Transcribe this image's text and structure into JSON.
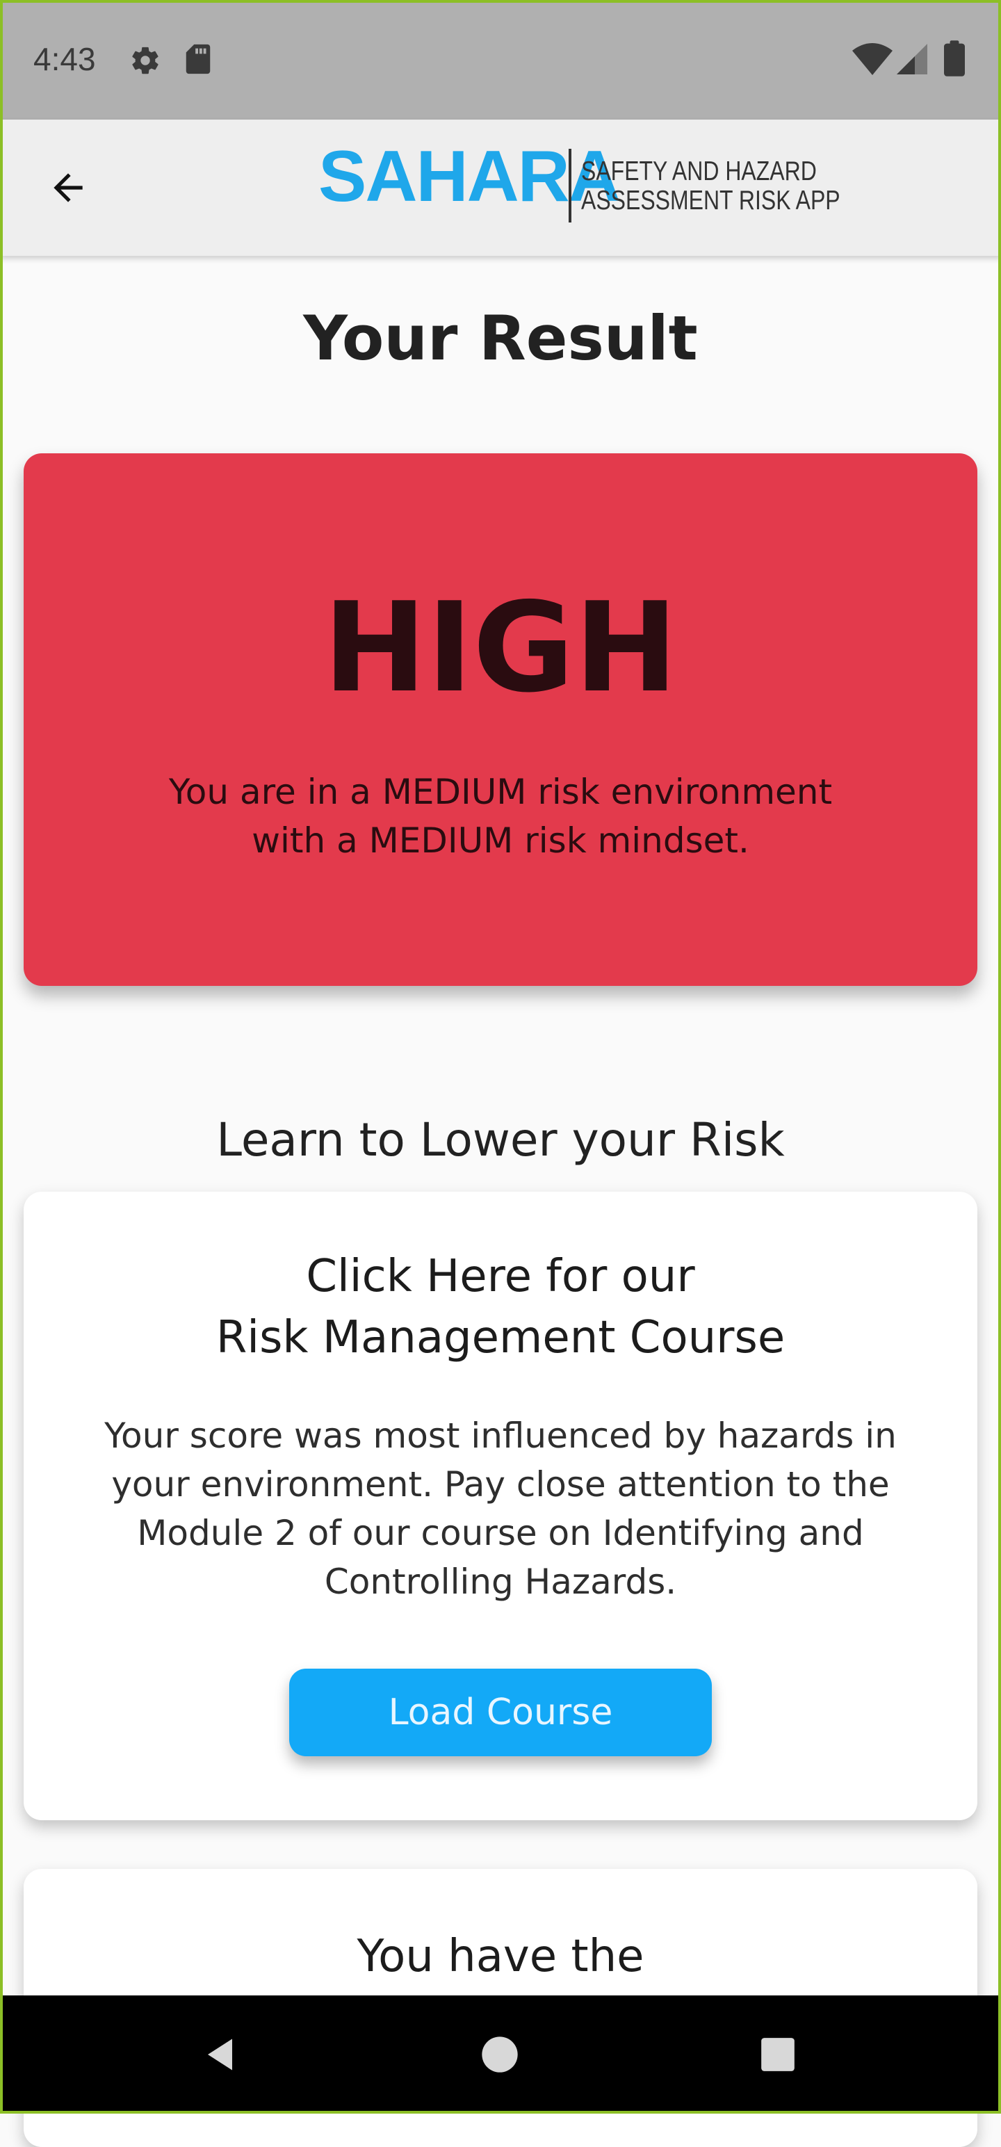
{
  "status_bar": {
    "time": "4:43",
    "left_icons": [
      "gear-icon",
      "sd-card-icon"
    ],
    "right_icons": [
      "wifi-icon",
      "cell-signal-icon",
      "battery-icon"
    ]
  },
  "app_bar": {
    "back_icon": "arrow-left-icon",
    "logo": {
      "word": "SAHARA",
      "subtitle_line1": "SAFETY AND HAZARD",
      "subtitle_line2": "ASSESSMENT RISK APP"
    }
  },
  "result": {
    "title": "Your Result",
    "level": "HIGH",
    "description": "You are in a MEDIUM risk environment\nwith a MEDIUM risk mindset.",
    "card_color": "#e33a4c"
  },
  "learn": {
    "heading": "Learn to Lower your Risk",
    "course_card": {
      "title": "Click Here for our\nRisk Management Course",
      "body": "Your score was most influenced by hazards in your environment. Pay close attention to the Module 2 of our course on Identifying and Controlling Hazards.",
      "button_label": "Load Course",
      "button_color": "#13a9f7"
    },
    "rights_card": {
      "title": "You have the\nRIGHT and RESPONSIBILITY"
    }
  },
  "nav_bar": {
    "icons": [
      "nav-back-icon",
      "nav-home-icon",
      "nav-recents-icon"
    ]
  }
}
